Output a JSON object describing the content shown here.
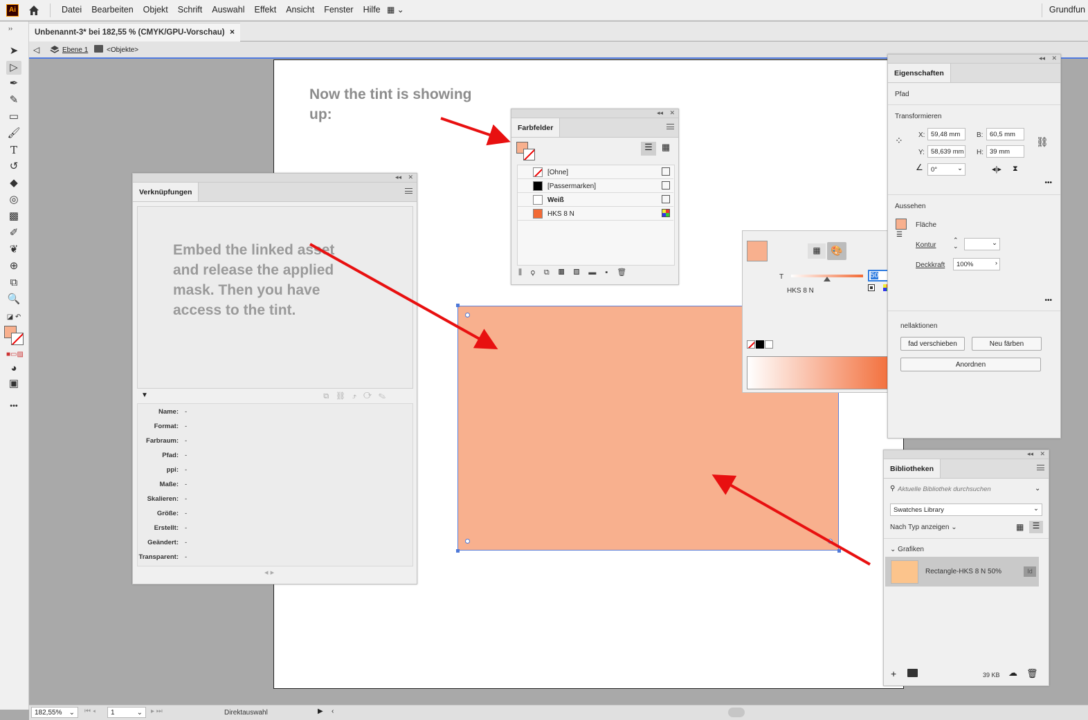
{
  "menubar": {
    "logo": "Ai",
    "items": [
      "Datei",
      "Bearbeiten",
      "Objekt",
      "Schrift",
      "Auswahl",
      "Effekt",
      "Ansicht",
      "Fenster",
      "Hilfe"
    ],
    "workspace": "Grundfun"
  },
  "document_tab": {
    "title": "Unbenannt-3* bei 182,55 % (CMYK/GPU-Vorschau)",
    "close": "×"
  },
  "breadcrumb": {
    "layer": "Ebene 1",
    "group": "<Objekte>"
  },
  "canvas": {
    "note_top": "Now the tint is showing up:",
    "note_links": "Embed the linked asset and release the applied mask. Then you have access to the tint.",
    "rect_fill": "#f8b08e",
    "arrow_color": "#e81010"
  },
  "links_panel": {
    "tab": "Verknüpfungen",
    "fields": [
      {
        "k": "Name:",
        "v": "-"
      },
      {
        "k": "Format:",
        "v": "-"
      },
      {
        "k": "Farbraum:",
        "v": "-"
      },
      {
        "k": "Pfad:",
        "v": "-"
      },
      {
        "k": "ppi:",
        "v": "-"
      },
      {
        "k": "Maße:",
        "v": "-"
      },
      {
        "k": "Skalieren:",
        "v": "-"
      },
      {
        "k": "Größe:",
        "v": "-"
      },
      {
        "k": "Erstellt:",
        "v": "-"
      },
      {
        "k": "Geändert:",
        "v": "-"
      },
      {
        "k": "Transparent:",
        "v": "-"
      }
    ]
  },
  "swatches_panel": {
    "tab": "Farbfelder",
    "rows": [
      {
        "name": "[Ohne]",
        "color": "none"
      },
      {
        "name": "[Passermarken]",
        "color": "#000000"
      },
      {
        "name": "Weiß",
        "color": "#ffffff"
      },
      {
        "name": "HKS 8 N",
        "color": "#f26a35"
      }
    ]
  },
  "color_panel": {
    "tint_label": "T",
    "tint_value": "50",
    "percent": "%",
    "swatch_name": "HKS 8 N",
    "tint_fraction": 0.5
  },
  "properties_panel": {
    "tab": "Eigenschaften",
    "object_type": "Pfad",
    "transform_title": "Transformieren",
    "x_label": "X:",
    "x": "59,48 mm",
    "y_label": "Y:",
    "y": "58,639 mm",
    "w_label": "B:",
    "w": "60,5 mm",
    "h_label": "H:",
    "h": "39 mm",
    "angle": "0°",
    "appearance_title": "Aussehen",
    "fill_label": "Fläche",
    "stroke_label": "Kontur",
    "opacity_label": "Deckkraft",
    "opacity": "100%",
    "quick_actions_title": "nellaktionen",
    "btn_move_path": "fad verschieben",
    "btn_recolor": "Neu färben",
    "btn_arrange": "Anordnen",
    "more": "•••"
  },
  "libraries_panel": {
    "tab": "Bibliotheken",
    "search_placeholder": "Aktuelle Bibliothek durchsuchen",
    "library": "Swatches Library",
    "view_by": "Nach Typ anzeigen",
    "section": "Grafiken",
    "item_name": "Rectangle-HKS 8 N 50%",
    "item_badge": "Id",
    "item_color": "#fcc48c",
    "size": "39 KB"
  },
  "status_bar": {
    "zoom": "182,55%",
    "artboard": "1",
    "tool": "Direktauswahl"
  }
}
